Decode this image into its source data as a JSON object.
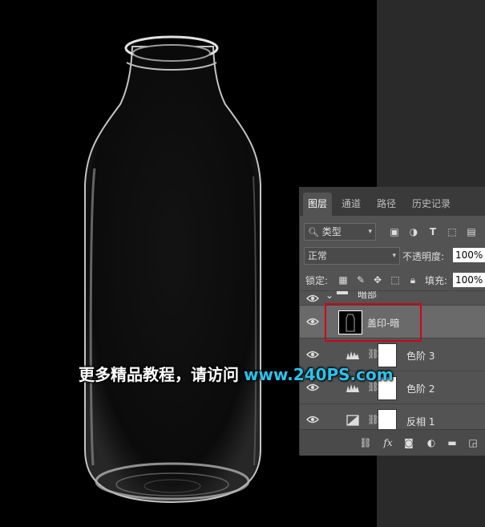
{
  "colors": {
    "panel_bg": "#535353",
    "selection": "#d0021b",
    "watermark_url": "#2bc3ee"
  },
  "tabs": [
    {
      "label": "图层",
      "active": true
    },
    {
      "label": "通道",
      "active": false
    },
    {
      "label": "路径",
      "active": false
    },
    {
      "label": "历史记录",
      "active": false
    }
  ],
  "filter": {
    "value": "类型"
  },
  "blend": {
    "mode": "正常",
    "opacity_label": "不透明度:",
    "opacity_value": "100%"
  },
  "lock": {
    "label": "锁定:",
    "fill_label": "填充:",
    "fill_value": "100%"
  },
  "group": {
    "name": "暗部"
  },
  "layers": [
    {
      "name": "盖印-暗",
      "selected": true
    },
    {
      "name": "色阶 3",
      "type": "levels"
    },
    {
      "name": "色阶 2",
      "type": "levels"
    },
    {
      "name": "反相 1",
      "type": "invert"
    }
  ],
  "watermark": {
    "text": "更多精品教程，请访问",
    "url": "www.240PS.com"
  }
}
